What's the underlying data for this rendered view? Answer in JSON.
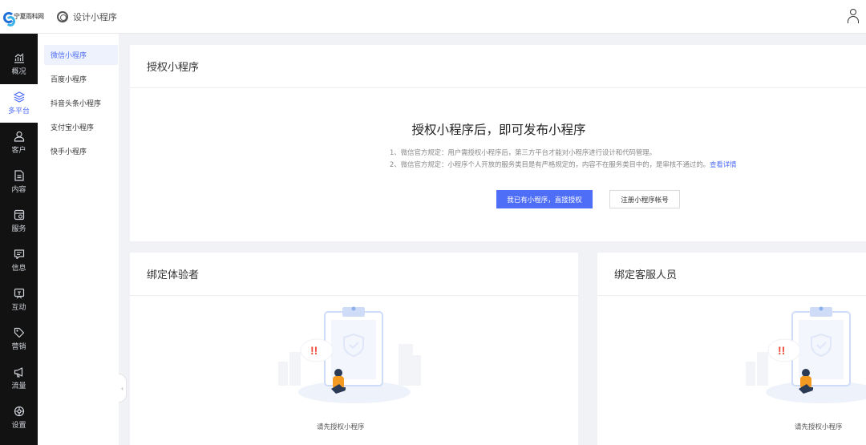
{
  "header": {
    "brand": "宁夏雨科网",
    "design_label": "设计小程序"
  },
  "sidebar": {
    "items": [
      {
        "label": "概况",
        "icon": "chart-icon"
      },
      {
        "label": "多平台",
        "icon": "layers-icon",
        "active": true
      },
      {
        "label": "客户",
        "icon": "user-icon"
      },
      {
        "label": "内容",
        "icon": "document-icon"
      },
      {
        "label": "服务",
        "icon": "service-icon"
      },
      {
        "label": "信息",
        "icon": "message-icon"
      },
      {
        "label": "互动",
        "icon": "interact-icon"
      },
      {
        "label": "营销",
        "icon": "tag-icon"
      },
      {
        "label": "流量",
        "icon": "megaphone-icon"
      },
      {
        "label": "设置",
        "icon": "settings-icon"
      }
    ]
  },
  "subnav": {
    "items": [
      {
        "label": "微信小程序",
        "active": true
      },
      {
        "label": "百度小程序"
      },
      {
        "label": "抖音头条小程序"
      },
      {
        "label": "支付宝小程序"
      },
      {
        "label": "快手小程序"
      }
    ]
  },
  "auth_card": {
    "title": "授权小程序",
    "headline": "授权小程序后，即可发布小程序",
    "note1": "1、微信官方规定：用户需授权小程序后，第三方平台才能对小程序进行设计和代码管理。",
    "note2": "2、微信官方规定：小程序个人开放的服务类目是有严格规定的，内容不在服务类目中的，是审核不通过的。",
    "note2_link": "查看详情",
    "primary_button": "我已有小程序，直接授权",
    "secondary_button": "注册小程序帐号"
  },
  "tester_card": {
    "title": "绑定体验者",
    "empty_text": "请先授权小程序"
  },
  "service_card": {
    "title": "绑定客服人员",
    "empty_text": "请先授权小程序"
  },
  "colors": {
    "accent": "#4f6ef7",
    "sidebar_bg": "#121212",
    "page_bg": "#f0f2f5"
  }
}
